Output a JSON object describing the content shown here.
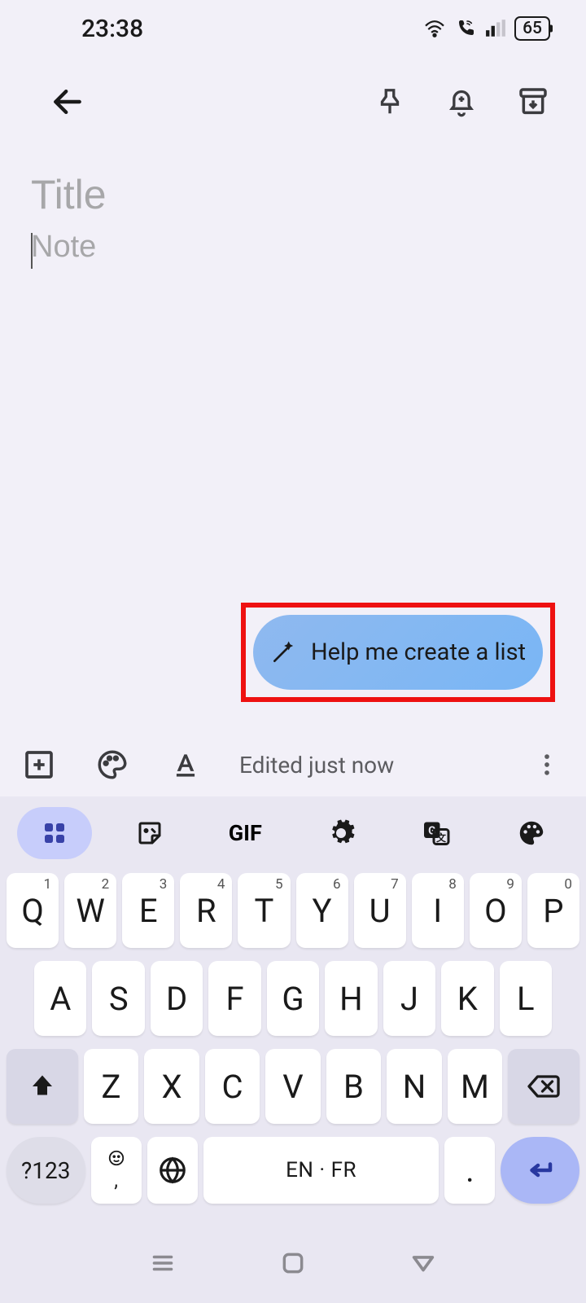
{
  "status": {
    "time": "23:38",
    "battery": "65"
  },
  "toolbar": {},
  "note": {
    "title_placeholder": "Title",
    "body_placeholder": "Note"
  },
  "suggestion": {
    "label": "Help me create a list"
  },
  "bottombar": {
    "edited_label": "Edited just now"
  },
  "keyboard": {
    "gif_label": "GIF",
    "row1": [
      {
        "k": "Q",
        "s": "1"
      },
      {
        "k": "W",
        "s": "2"
      },
      {
        "k": "E",
        "s": "3"
      },
      {
        "k": "R",
        "s": "4"
      },
      {
        "k": "T",
        "s": "5"
      },
      {
        "k": "Y",
        "s": "6"
      },
      {
        "k": "U",
        "s": "7"
      },
      {
        "k": "I",
        "s": "8"
      },
      {
        "k": "O",
        "s": "9"
      },
      {
        "k": "P",
        "s": "0"
      }
    ],
    "row2": [
      "A",
      "S",
      "D",
      "F",
      "G",
      "H",
      "J",
      "K",
      "L"
    ],
    "row3": [
      "Z",
      "X",
      "C",
      "V",
      "B",
      "N",
      "M"
    ],
    "sym_label": "?123",
    "comma": ",",
    "space_label": "EN · FR",
    "dot": "."
  }
}
